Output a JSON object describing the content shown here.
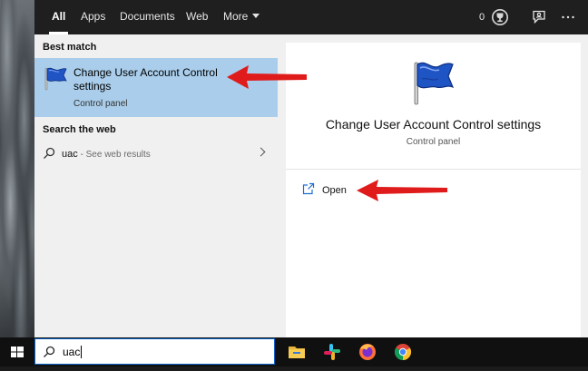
{
  "tabs": [
    {
      "label": "All",
      "active": true
    },
    {
      "label": "Apps"
    },
    {
      "label": "Documents"
    },
    {
      "label": "Web"
    },
    {
      "label": "More"
    }
  ],
  "topbar": {
    "rewards_count": "0"
  },
  "results": {
    "best_match_header": "Best match",
    "best_match": {
      "title": "Change User Account Control settings",
      "subtitle": "Control panel",
      "icon": "uac-flag-icon"
    },
    "search_web_header": "Search the web",
    "web_result": {
      "query": "uac",
      "suffix": " - See web results"
    }
  },
  "preview": {
    "title": "Change User Account Control settings",
    "subtitle": "Control panel",
    "action_label": "Open"
  },
  "taskbar": {
    "search_value": "uac",
    "apps": [
      "file-explorer-icon",
      "slack-icon",
      "firefox-icon",
      "chrome-icon"
    ]
  },
  "colors": {
    "selection": "#a9cdea",
    "annotation_arrow": "#e01b1b",
    "topbar": "#1f1f1f",
    "taskbar": "#101010"
  }
}
